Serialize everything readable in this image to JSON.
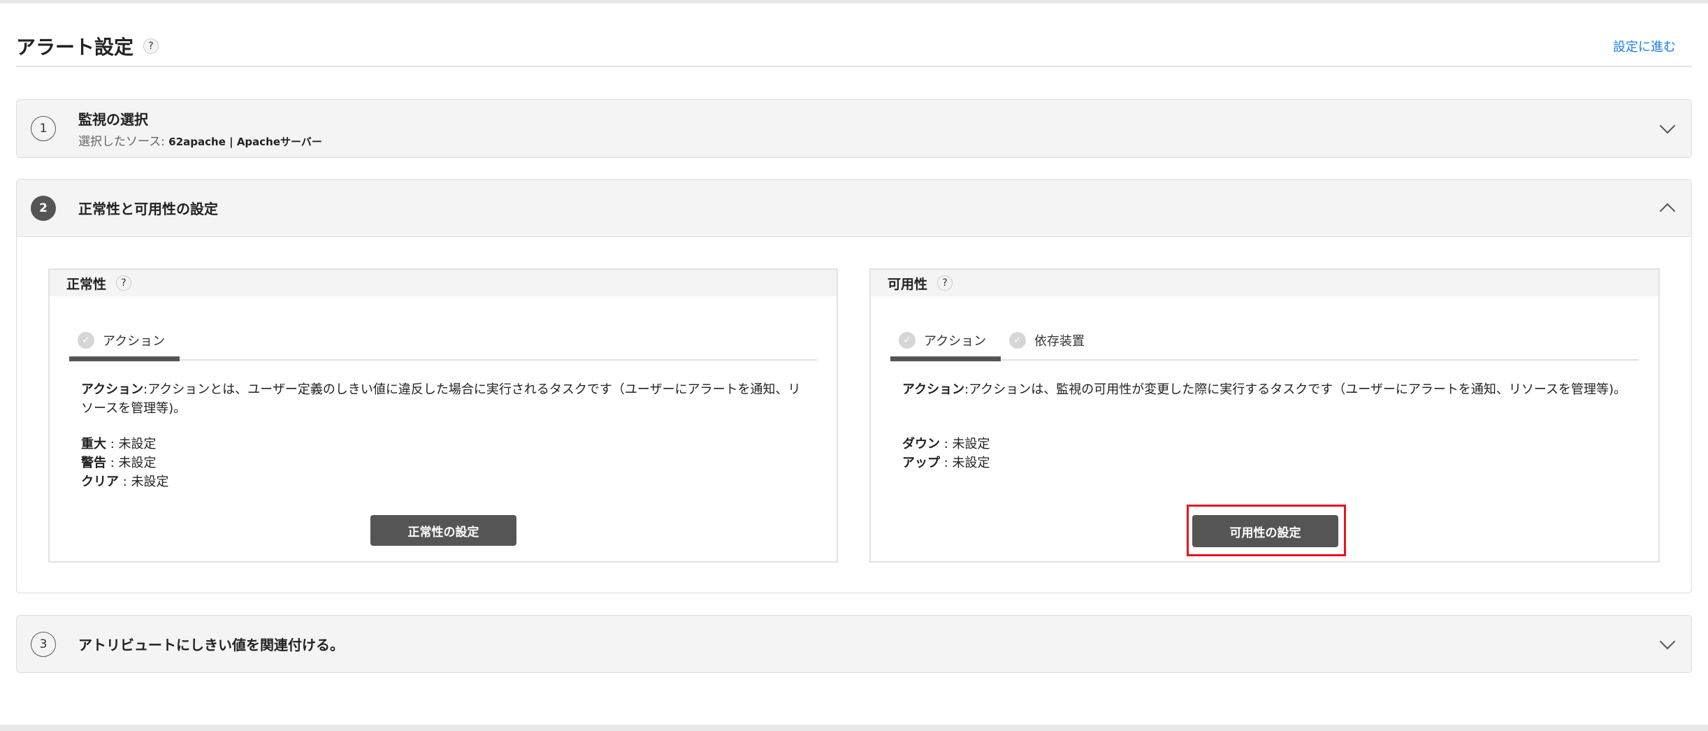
{
  "header": {
    "title": "アラート設定",
    "help": "?",
    "next_link": "設定に進む"
  },
  "sections": [
    {
      "number": "1",
      "title": "監視の選択",
      "subtitle_label": "選択したソース:",
      "subtitle_value": "62apache | Apacheサーバー",
      "expanded": false
    },
    {
      "number": "2",
      "title": "正常性と可用性の設定",
      "expanded": true
    },
    {
      "number": "3",
      "title": "アトリビュートにしきい値を関連付ける。",
      "expanded": false
    }
  ],
  "health": {
    "title": "正常性",
    "help": "?",
    "tabs": [
      {
        "label": "アクション",
        "active": true
      }
    ],
    "desc_label": "アクション",
    "desc_sep": ":",
    "desc_text": "アクションとは、ユーザー定義のしきい値に違反した場合に実行されるタスクです（ユーザーにアラートを通知、リソースを管理等)。",
    "values": [
      {
        "label": "重大",
        "value": "未設定"
      },
      {
        "label": "警告",
        "value": "未設定"
      },
      {
        "label": "クリア",
        "value": "未設定"
      }
    ],
    "button": "正常性の設定"
  },
  "availability": {
    "title": "可用性",
    "help": "?",
    "tabs": [
      {
        "label": "アクション",
        "active": true
      },
      {
        "label": "依存装置",
        "active": false
      }
    ],
    "desc_label": "アクション",
    "desc_sep": ":",
    "desc_text": "アクションは、監視の可用性が変更した際に実行するタスクです（ユーザーにアラートを通知、リソースを管理等)。",
    "values": [
      {
        "label": "ダウン",
        "value": "未設定"
      },
      {
        "label": "アップ",
        "value": "未設定"
      }
    ],
    "button": "可用性の設定"
  },
  "colors": {
    "link": "#1a7ee6",
    "button": "#555555",
    "highlight": "#e8141c"
  }
}
